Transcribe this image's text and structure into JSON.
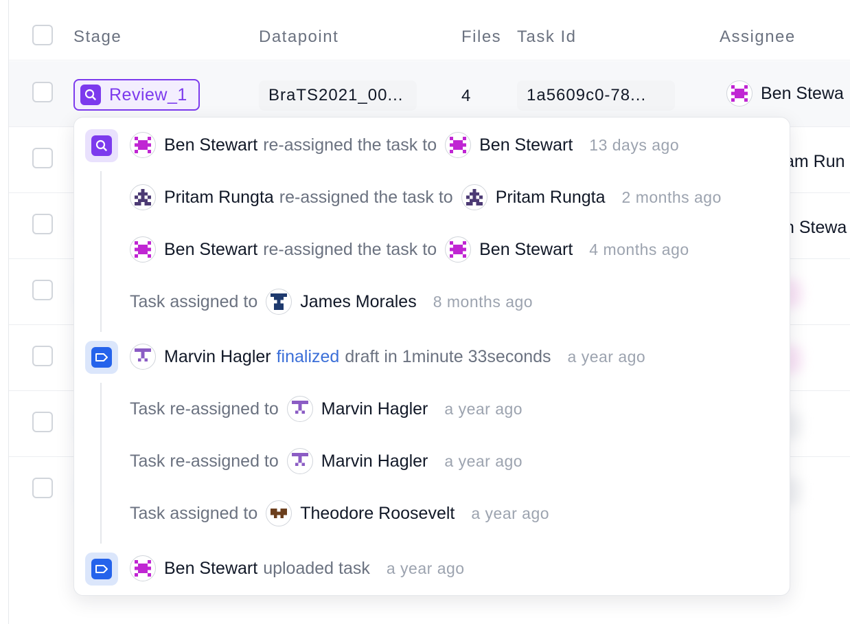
{
  "table": {
    "headers": {
      "stage": "Stage",
      "datapoint": "Datapoint",
      "files": "Files",
      "task_id": "Task Id",
      "assignee": "Assignee"
    },
    "first_row": {
      "stage": "Review_1",
      "datapoint": "BraTS2021_00...",
      "files": "4",
      "task_id": "1a5609c0-78...",
      "assignee": "Ben Stewa"
    },
    "partial_assignees": [
      "am Run",
      "n Stewa"
    ]
  },
  "history": {
    "groups": [
      {
        "stage_icon": "review-search-icon",
        "entries": [
          {
            "actor": "Ben Stewart",
            "action": "re-assigned the task to",
            "target": "Ben Stewart",
            "time": "13 days ago"
          },
          {
            "actor": "Pritam Rungta",
            "action": "re-assigned the task to",
            "target": "Pritam Rungta",
            "time": "2 months ago"
          },
          {
            "actor": "Ben Stewart",
            "action": "re-assigned the task to",
            "target": "Ben Stewart",
            "time": "4 months ago"
          },
          {
            "prefix": "Task assigned to",
            "target": "James Morales",
            "time": "8 months ago"
          }
        ]
      },
      {
        "stage_icon": "label-tag-icon",
        "entries": [
          {
            "actor": "Marvin Hagler",
            "link": "finalized",
            "action": "draft in 1minute 33seconds",
            "time": "a year ago"
          },
          {
            "prefix": "Task re-assigned to",
            "target": "Marvin Hagler",
            "time": "a year ago"
          },
          {
            "prefix": "Task re-assigned to",
            "target": "Marvin Hagler",
            "time": "a year ago"
          },
          {
            "prefix": "Task assigned to",
            "target": "Theodore Roosevelt",
            "time": "a year ago"
          }
        ]
      },
      {
        "stage_icon": "label-tag-icon",
        "entries": [
          {
            "actor": "Ben Stewart",
            "action": "uploaded task",
            "time": "a year ago"
          }
        ]
      }
    ]
  },
  "colors": {
    "review_accent": "#7c3aed",
    "label_accent": "#2563eb",
    "link": "#3b6fd8",
    "avatar_ben": "#c026d3",
    "avatar_pritam": "#4c3a74",
    "avatar_james": "#1e3a6e",
    "avatar_marvin": "#8b5cc4",
    "avatar_theodore": "#6b3f1d"
  }
}
